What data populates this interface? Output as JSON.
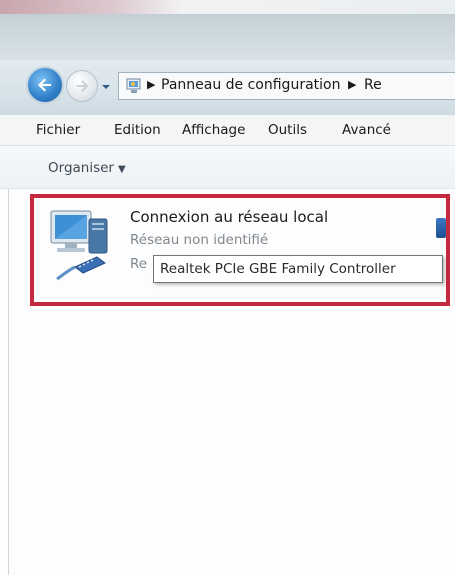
{
  "address_bar": {
    "segments": [
      "Panneau de configuration",
      "Re"
    ]
  },
  "menu": {
    "items": [
      "Fichier",
      "Edition",
      "Affichage",
      "Outils",
      "Avancé"
    ]
  },
  "command_bar": {
    "organise_label": "Organiser"
  },
  "connection": {
    "name": "Connexion au réseau local",
    "status": "Réseau non identifié",
    "device_partial": "Re",
    "tooltip": "Realtek PCIe GBE Family Controller"
  },
  "icons": {
    "back": "back-arrow-icon",
    "forward": "forward-arrow-icon",
    "recent": "chevron-down-icon",
    "address": "control-panel-icon",
    "connection": "network-connection-icon"
  },
  "colors": {
    "highlight_border": "#c42a3e",
    "back_button": "#2f7fc8"
  }
}
